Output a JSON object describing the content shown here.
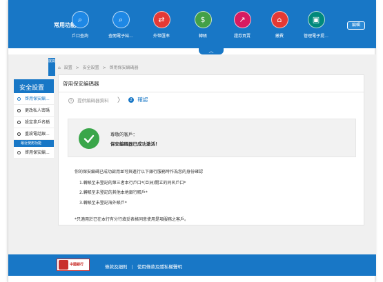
{
  "topbar": {
    "caption": "常用功能",
    "items": [
      {
        "label": "戶口查詢",
        "icon": "account-search-icon",
        "glyph": "⌕",
        "color": "#1e88e5"
      },
      {
        "label": "查閱電子結...",
        "icon": "statement-search-icon",
        "glyph": "⌕",
        "color": "#1e88e5"
      },
      {
        "label": "外幣匯率",
        "icon": "currency-exchange-icon",
        "glyph": "⇄",
        "color": "#e53935"
      },
      {
        "label": "轉賬",
        "icon": "transfer-icon",
        "glyph": "$",
        "color": "#43a047"
      },
      {
        "label": "證券買賣",
        "icon": "securities-trading-icon",
        "glyph": "↗",
        "color": "#d81b60"
      },
      {
        "label": "繳費",
        "icon": "bill-payment-icon",
        "glyph": "⌂",
        "color": "#e53935"
      },
      {
        "label": "管理電子提...",
        "icon": "e-notice-management-icon",
        "glyph": "▣",
        "color": "#00897b"
      }
    ],
    "edit_label": "編輯",
    "collapse_glyph": "︿"
  },
  "toggle": {
    "label": "展開"
  },
  "breadcrumb": {
    "home": "⌂",
    "items": [
      "設置",
      "安全設置",
      "啓用保安編碼器"
    ],
    "separator": ">"
  },
  "sidebar": {
    "title": "安全設置",
    "items": [
      "啓用保安編...",
      "更改私人密碼",
      "設定拿戶名稱",
      "重設電話銀..."
    ],
    "recent_header": "最近使用功能",
    "recent_items": [
      "啓用保安編..."
    ]
  },
  "card": {
    "title": "啓用保安編碼器",
    "steps": [
      {
        "num": "1",
        "label": "提供編碼器資料"
      },
      {
        "num": "2",
        "label": "確認"
      }
    ],
    "chevron": "〉",
    "message_greeting": "尊敬的客戶：",
    "message_success": "保安編碼器已成功激活！",
    "intro": "你的保安編碼已成功啟用並可與進行以下銀行服務時作為您的身份確認",
    "list": [
      "1.轉賬至未登記的第三者本行戶口*(亞洲)開立的同名戶口*",
      "2.轉賬至未登記的其他本地銀行賬戶*",
      "3.轉賬至未登記海外賬戶*"
    ],
    "note": "*只適用於已在本行有分行填妥表格同意使用是項服務之客戶。"
  },
  "footer": {
    "logo_text": "中國銀行",
    "links": [
      "條款及細則",
      "使用條款及隱私權聲明"
    ],
    "divider": "|"
  },
  "colors": {
    "brand": "#1877c6",
    "success": "#3aa64a"
  }
}
